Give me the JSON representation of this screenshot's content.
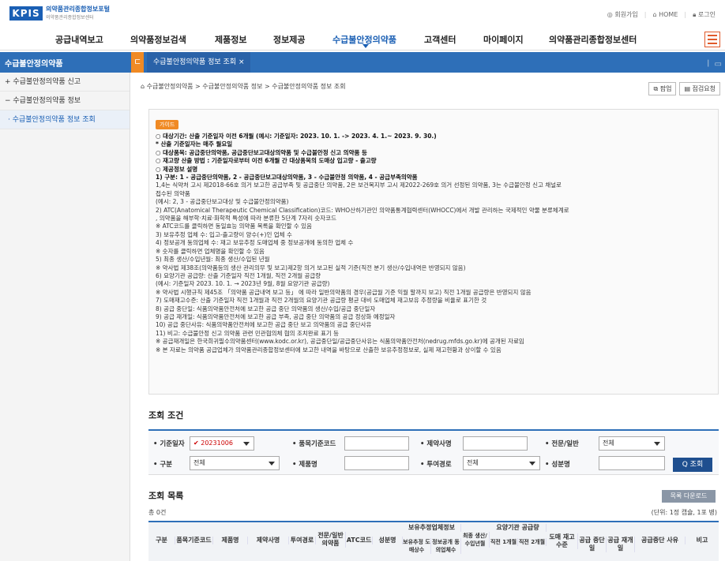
{
  "header": {
    "logo": "KPIS",
    "site_title": "의약품관리종합정보포털",
    "site_sub": "의약품관리종합정보센터",
    "util": [
      "회원가입",
      "HOME",
      "로그인"
    ]
  },
  "gnb": [
    "공급내역보고",
    "의약품정보검색",
    "제품정보",
    "정보제공",
    "수급불안정의약품",
    "고객센터",
    "마이페이지",
    "의약품관리종합정보센터"
  ],
  "bar": {
    "section": "수급불안정의약품",
    "home_glyph": "ㄷ",
    "tab": "수급불안정의약품 정보 조회 ×",
    "right_glyph": "ㅣ ▭"
  },
  "sidebar": [
    {
      "label": "+ 수급불안정의약품 신고"
    },
    {
      "label": "− 수급불안정의약품 정보"
    },
    {
      "label": "· 수급불안정의약품 정보 조회"
    }
  ],
  "breadcrumb": "⌂ 수급불안정의약품 > 수급불안정의약품 정보 > 수급불안정의약품 정보 조회",
  "buttons": {
    "popup": "팝업",
    "check": "점검요청"
  },
  "guide": {
    "badge": "가이드",
    "lines": [
      {
        "t": "○ 대상기간: 산출 기준일자 이전 6개월 (예시: 기준일자: 2023. 10. 1. -> 2023. 4. 1.~ 2023. 9. 30.)",
        "b": true
      },
      {
        "t": "    * 산출 기준일자는 매주 월요일",
        "b": true
      },
      {
        "t": "○ 대상품목: 공급중단의약품, 공급중단보고대상의약품 및 수급불안정 신고 의약품 등",
        "b": true
      },
      {
        "t": "○ 재고량 산출 방법 : 기준일자로부터 이전 6개월 간 대상품목의 도매상 입고량 - 출고량",
        "b": true
      },
      {
        "t": "○ 제공정보 설명",
        "b": true
      },
      {
        "t": "    1) 구분: 1 - 공급중단의약품, 2 - 공급중단보고대상의약품, 3 - 수급불안정 의약품, 4 - 공급부족의약품",
        "b": true
      },
      {
        "t": "         1,4는 식약처 고시 제2018-66호 의거 보고한 공급부족 및 공급중단 의약품, 2은 보건복지부 고시 제2022-269호 의거 선정된 의약품, 3는 수급불안정 신고 채널로",
        "b": false
      },
      {
        "t": "         접수된 의약품",
        "b": false
      },
      {
        "t": "         (예시: 2, 3 - 공급중단보고대상 및 수급불안정의약품)",
        "b": false
      },
      {
        "t": "    2) ATC(Anatomical Therapeutic Chemical Classification)코드: WHO산하기관인 의약품통계협력센터(WHOCC)에서 개발 관리하는 국제적인 약물 분류체계로",
        "b": false
      },
      {
        "t": "       , 의약품을 해부학·치료·화학적 특성에 따라 분류한 5단계 7자리 숫자코드",
        "b": false
      },
      {
        "t": "         ※ ATC코드를 클릭하면 동일효능 의약품 목록을 확인할 수 있음",
        "b": false
      },
      {
        "t": "    3) 보유추정 업체 수: 입고-출고량이 양수(+)인 업체 수",
        "b": false
      },
      {
        "t": "    4) 정보공개 동의업체 수: 재고 보유추정 도매업체 중 정보공개에 동의한 업체 수",
        "b": false
      },
      {
        "t": "         ※ 숫자를 클릭하면 업체명을 확인할 수 있음",
        "b": false
      },
      {
        "t": "    5) 최종 생산/수입년월: 최종 생산/수입된 년월",
        "b": false
      },
      {
        "t": "         ※ 약사법 제38조(의약품등의 생산 관리의무 및 보고)제2항 의거 보고된 실적 기준(직전 분기 생산/수입내역은 반영되지 않음)",
        "b": false
      },
      {
        "t": "    6) 요양기관 공급량: 산출 기준일자 직전 1개월, 직전 2개월 공급량",
        "b": false
      },
      {
        "t": "                          (예시: 기준일자 2023. 10. 1. → 2023년 9월, 8월 요양기관 공급량)",
        "b": false
      },
      {
        "t": "         ※ 약사법 시행규칙 제45조 「의약품 공급내역 보고 등」 에 따라 일반의약품의 경우(공급월 기준 익월 말까지 보고) 직전 1개월 공급량은 반영되지 않음",
        "b": false
      },
      {
        "t": "    7) 도매재고수준: 산출 기준일자 직전 1개월과 직전 2개월의 요양기관 공급량 평균 대비 도매업체 재고보유 추정량을 비율로 표기한 것",
        "b": false
      },
      {
        "t": " ",
        "b": false
      },
      {
        "t": "    8) 공급 중단일: 식품의약품안전처에 보고한 공급 중단 의약품의 생산/수입/공급 중단일자",
        "b": false
      },
      {
        "t": "    9) 공급 재개일: 식품의약품안전처에 보고한 공급 부족, 공급 중단 의약품의 공급 정상화 예정일자",
        "b": false
      },
      {
        "t": "    10) 공급 중단사유: 식품의약품안전처에 보고한 공급 중단 보고 의약품의 공급 중단사유",
        "b": false
      },
      {
        "t": "    11) 비고: 수급불안정 신고 의약품 관련 민관협의체 협의 조치완료 표기 등",
        "b": false
      },
      {
        "t": " ",
        "b": false
      },
      {
        "t": "※ 공급재개일은 한국희귀필수의약품센터(www.kodc.or.kr), 공급중단일/공급중단사유는 식품의약품안전처(nedrug.mfds.go.kr)에 공개된 자료임",
        "b": false
      },
      {
        "t": "※ 본 자료는 의약품 공급업체가 의약품관리종합정보센터에 보고한 내역을 바탕으로 산출한 보유추정정보로, 실제 재고현황과 상이할 수 있음",
        "b": false
      }
    ]
  },
  "search": {
    "title": "조회 조건",
    "labels": [
      "• 기준일자",
      "• 품목기준코드",
      "• 제약사명",
      "• 전문/일반",
      "• 구분",
      "• 제품명",
      "• 투여경로",
      "• 성분명"
    ],
    "date_value": "✔ 20231006",
    "pro_value": "전체",
    "type_value": "전체",
    "route_value": "전체",
    "button": "Q 조회"
  },
  "list": {
    "title": "조회 목록",
    "download": "목록 다운로드",
    "count": "총 0건",
    "unit": "(단위: 1정 캡슐, 1포 병)",
    "headers": [
      "구분",
      "품목기준코드",
      "제품명",
      "제약사명",
      "투여경로",
      "전문/일반 의약품",
      "ATC코드",
      "성분명",
      "보유추정업체정보",
      "보유추정 도매상수",
      "정보공개 동의업체수",
      "최종 생산/수입년월",
      "요양기관 공급량",
      "직전 1개월",
      "직전 2개월",
      "도매 재고수준",
      "공급 중단일",
      "공급 재개일",
      "공급중단 사유",
      "비고"
    ]
  }
}
